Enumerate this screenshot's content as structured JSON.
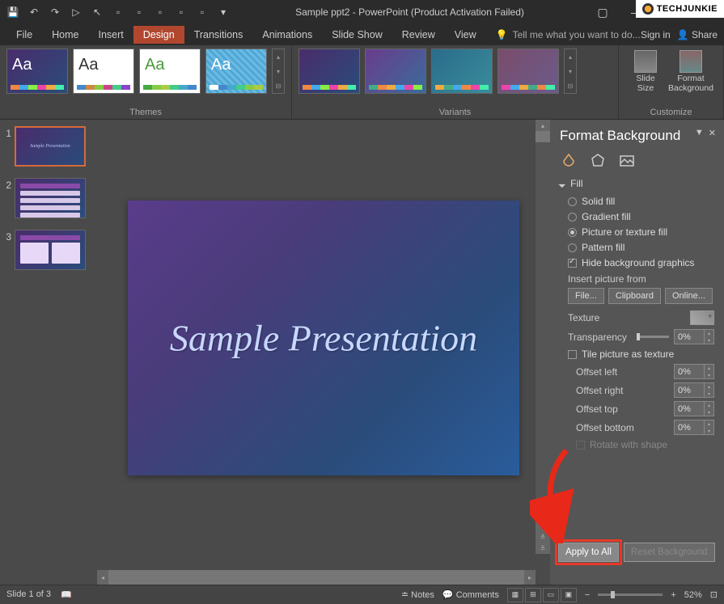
{
  "watermark": "TECHJUNKIE",
  "title": "Sample ppt2 - PowerPoint (Product Activation Failed)",
  "menubar": {
    "file": "File",
    "home": "Home",
    "insert": "Insert",
    "design": "Design",
    "transitions": "Transitions",
    "animations": "Animations",
    "slideshow": "Slide Show",
    "review": "Review",
    "view": "View",
    "tellme": "Tell me what you want to do...",
    "signin": "Sign in",
    "share": "Share"
  },
  "ribbon": {
    "themes_label": "Themes",
    "variants_label": "Variants",
    "customize_label": "Customize",
    "slide_size": "Slide\nSize",
    "format_bg": "Format\nBackground"
  },
  "slides": {
    "count": 3,
    "items": [
      {
        "num": "1"
      },
      {
        "num": "2"
      },
      {
        "num": "3"
      }
    ]
  },
  "canvas": {
    "title_text": "Sample Presentation"
  },
  "pane": {
    "title": "Format Background",
    "section_fill": "Fill",
    "solid": "Solid fill",
    "gradient": "Gradient fill",
    "picture": "Picture or texture fill",
    "pattern": "Pattern fill",
    "hide_bg": "Hide background graphics",
    "insert_from": "Insert picture from",
    "file_btn": "File...",
    "clipboard_btn": "Clipboard",
    "online_btn": "Online...",
    "texture": "Texture",
    "transparency": "Transparency",
    "transparency_val": "0%",
    "tile": "Tile picture as texture",
    "offset_left": "Offset left",
    "offset_right": "Offset right",
    "offset_top": "Offset top",
    "offset_bottom": "Offset bottom",
    "offset_val": "0%",
    "rotate": "Rotate with shape",
    "apply_all": "Apply to All",
    "reset": "Reset Background"
  },
  "status": {
    "slide_info": "Slide 1 of 3",
    "notes": "Notes",
    "comments": "Comments",
    "zoom": "52%"
  }
}
